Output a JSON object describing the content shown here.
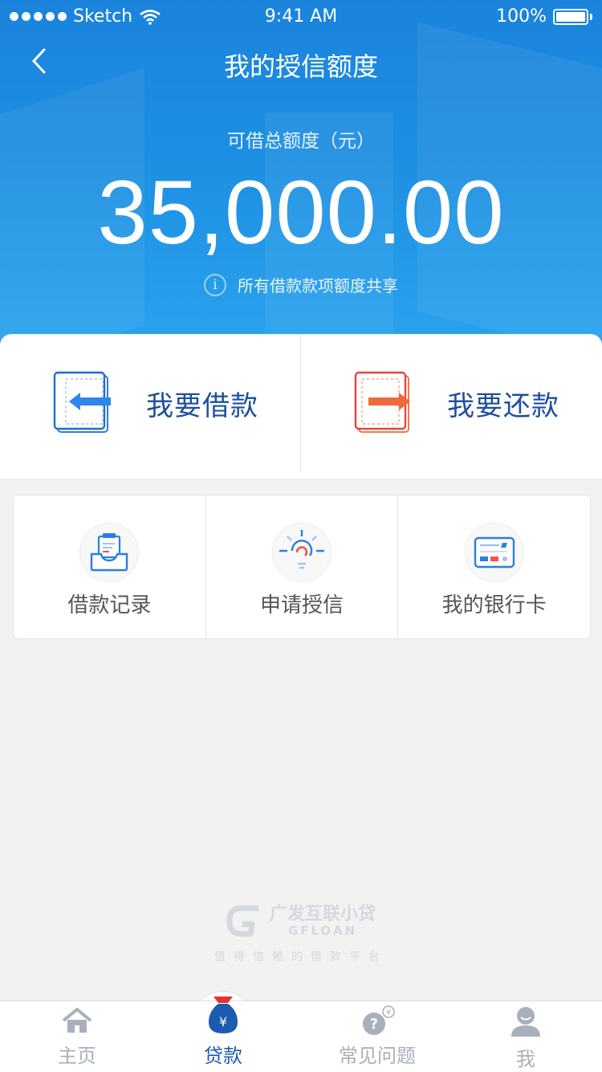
{
  "status_bar": {
    "carrier": "Sketch",
    "time": "9:41 AM",
    "battery": "100%"
  },
  "nav": {
    "title": "我的授信额度"
  },
  "credit": {
    "label": "可借总额度（元）",
    "amount": "35,000.00",
    "note": "所有借款款项额度共享"
  },
  "actions": [
    {
      "label": "我要借款"
    },
    {
      "label": "我要还款"
    }
  ],
  "grid": [
    {
      "label": "借款记录",
      "icon": "record-tray-icon"
    },
    {
      "label": "申请授信",
      "icon": "lightbulb-icon"
    },
    {
      "label": "我的银行卡",
      "icon": "bank-card-icon"
    }
  ],
  "brand": {
    "name": "广发互联小贷",
    "english": "GFLOAN",
    "slogan": "值得信赖的借款平台"
  },
  "tabbar": [
    {
      "label": "主页",
      "icon": "home-icon"
    },
    {
      "label": "贷款",
      "icon": "money-bag-icon",
      "active": true
    },
    {
      "label": "常见问题",
      "icon": "help-icon"
    },
    {
      "label": "我",
      "icon": "profile-icon"
    }
  ],
  "colors": {
    "primary": "#1d8fe2",
    "nav_text": "#1e4f9c",
    "active_tab": "#1d5bb0",
    "repay_red": "#e8443a"
  }
}
